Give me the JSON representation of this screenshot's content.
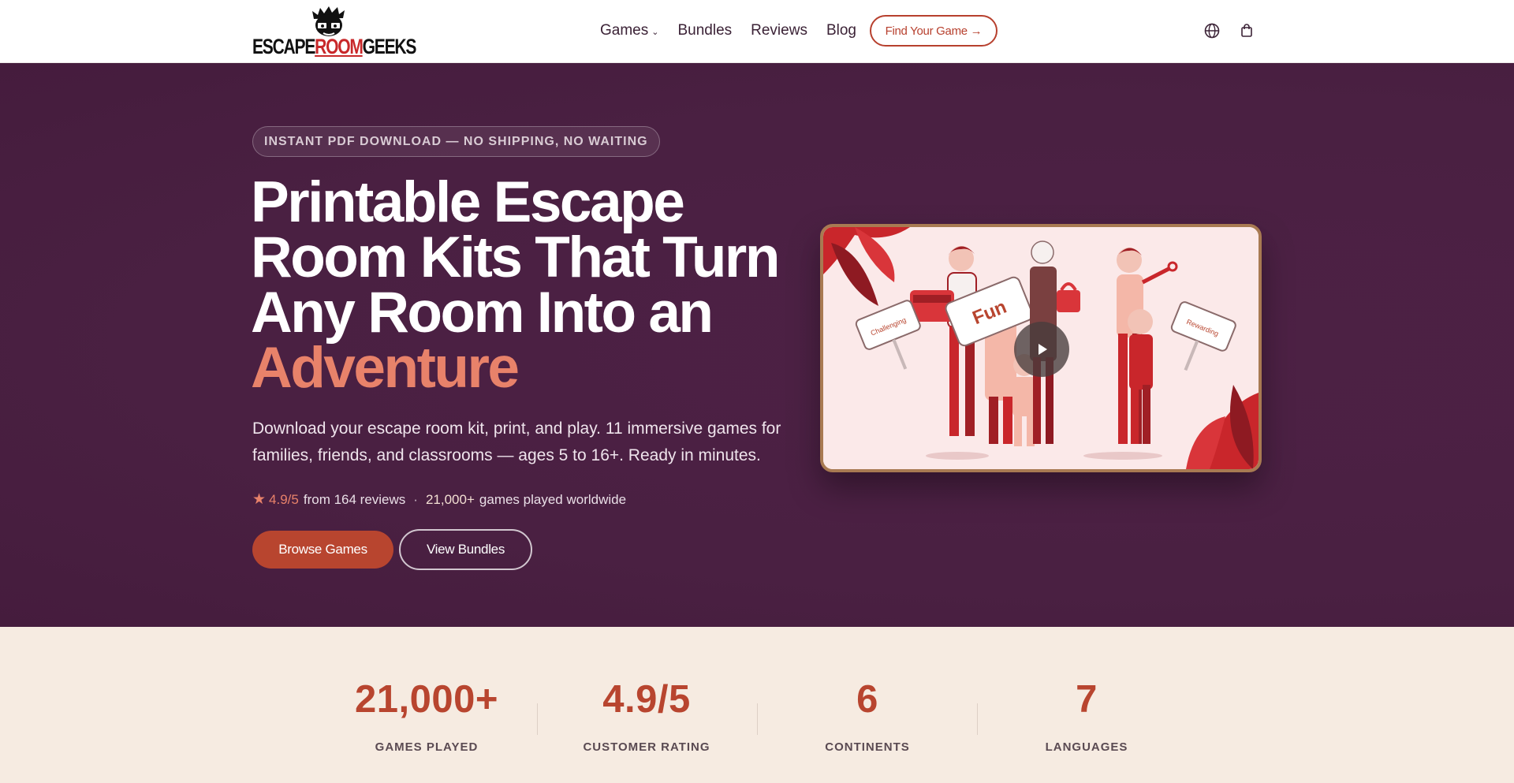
{
  "header": {
    "logo": {
      "part1": "ESCAPE",
      "part2": "ROOM",
      "part3": "GEEKS"
    },
    "nav": [
      {
        "label": "Games",
        "has_dropdown": true
      },
      {
        "label": "Bundles"
      },
      {
        "label": "Reviews"
      },
      {
        "label": "Blog"
      }
    ],
    "cta_label": "Find Your Game →",
    "icons": [
      "globe-icon",
      "shopping-bag-icon"
    ]
  },
  "hero": {
    "eyebrow": "INSTANT PDF DOWNLOAD — NO SHIPPING, NO WAITING",
    "title_line1": "Printable Escape",
    "title_line2": "Room Kits That Turn",
    "title_line3": "Any Room Into an",
    "title_accent": "Adventure",
    "subtitle": "Download your escape room kit, print, and play. 11 immersive games for families, friends, and classrooms — ages 5 to 16+. Ready in minutes.",
    "rating": {
      "score": "4.9/5",
      "reviews_text": "from 164 reviews",
      "separator": "·",
      "played": "21,000+",
      "played_text": "games played worldwide"
    },
    "primary_button": "Browse Games",
    "secondary_button": "View Bundles",
    "video": {
      "sign_left": "Challenging",
      "sign_center": "Fun",
      "sign_right": "Rewarding"
    }
  },
  "stats": [
    {
      "value": "21,000+",
      "label": "GAMES PLAYED"
    },
    {
      "value": "4.9/5",
      "label": "CUSTOMER RATING"
    },
    {
      "value": "6",
      "label": "CONTINENTS"
    },
    {
      "value": "7",
      "label": "LANGUAGES"
    }
  ],
  "colors": {
    "hero_bg": "#4a2042",
    "accent": "#e8826a",
    "brand": "#b8452f",
    "stats_bg": "#f6ebe1"
  }
}
